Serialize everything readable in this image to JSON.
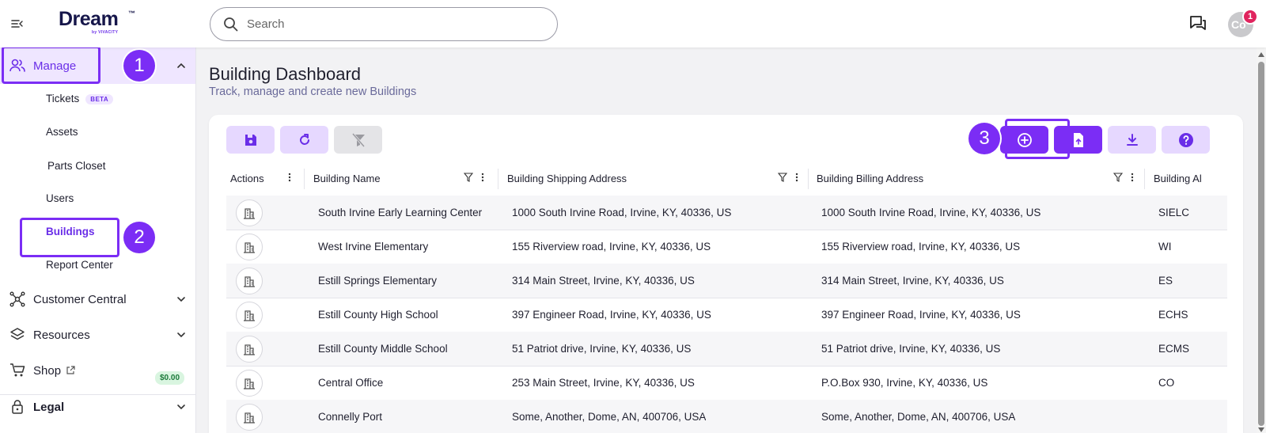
{
  "header": {
    "logo_text": "Dream",
    "logo_tm": "™",
    "logo_byline": "by VIVACITY",
    "search_placeholder": "Search",
    "avatar_text": "Co",
    "notification_count": "1"
  },
  "sidebar": {
    "manage_label": "Manage",
    "sub_items": {
      "tickets": "Tickets",
      "tickets_badge": "BETA",
      "assets": "Assets",
      "parts_closet": "Parts Closet",
      "users": "Users",
      "buildings": "Buildings",
      "report_center": "Report Center"
    },
    "customer_central": "Customer Central",
    "resources": "Resources",
    "shop": "Shop",
    "shop_badge": "$0.00",
    "legal": "Legal"
  },
  "annotations": {
    "step1": "1",
    "step2": "2",
    "step3": "3"
  },
  "page": {
    "title": "Building Dashboard",
    "subtitle": "Track, manage and create new Buildings"
  },
  "table": {
    "headers": {
      "actions": "Actions",
      "name": "Building Name",
      "shipping": "Building Shipping Address",
      "billing": "Building Billing Address",
      "abbr": "Building Al"
    },
    "rows": [
      {
        "name": "South Irvine Early Learning Center",
        "shipping": "1000 South Irvine Road, Irvine, KY, 40336, US",
        "billing": "1000 South Irvine Road, Irvine, KY, 40336, US",
        "abbr": "SIELC"
      },
      {
        "name": "West Irvine Elementary",
        "shipping": "155 Riverview road, Irvine, KY, 40336, US",
        "billing": "155 Riverview road, Irvine, KY, 40336, US",
        "abbr": "WI"
      },
      {
        "name": "Estill Springs Elementary",
        "shipping": "314 Main Street, Irvine, KY, 40336, US",
        "billing": "314 Main Street, Irvine, KY, 40336, US",
        "abbr": "ES"
      },
      {
        "name": "Estill County High School",
        "shipping": "397 Engineer Road, Irvine, KY, 40336, US",
        "billing": "397 Engineer Road, Irvine, KY, 40336, US",
        "abbr": "ECHS"
      },
      {
        "name": "Estill County Middle School",
        "shipping": "51 Patriot drive, Irvine, KY, 40336, US",
        "billing": "51 Patriot drive, Irvine, KY, 40336, US",
        "abbr": "ECMS"
      },
      {
        "name": "Central Office",
        "shipping": "253 Main Street, Irvine, KY, 40336, US",
        "billing": "P.O.Box 930, Irvine, KY, 40336, US",
        "abbr": "CO"
      },
      {
        "name": "Connelly Port",
        "shipping": "Some, Another, Dome, AN, 400706, USA",
        "billing": "Some, Another, Dome, AN, 400706, USA",
        "abbr": ""
      }
    ]
  },
  "colors": {
    "accent": "#7b2df5",
    "accent_light": "#e6d8ff",
    "nav_active_bg": "#efe6ff"
  }
}
